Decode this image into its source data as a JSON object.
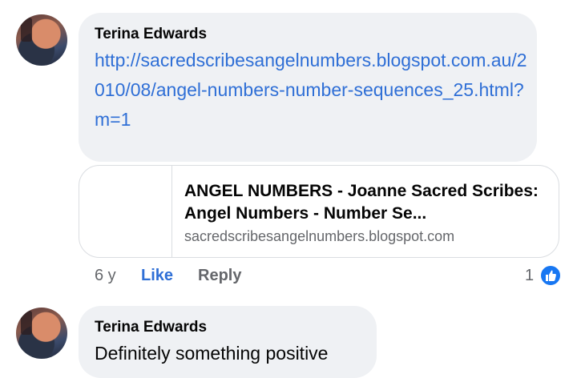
{
  "comments": [
    {
      "author": "Terina Edwards",
      "text": "http://sacredscribesangelnumbers.blogspot.com.au/2010/08/angel-numbers-number-sequences_25.html?m=1",
      "link_preview": {
        "title": "ANGEL NUMBERS - Joanne Sacred Scribes: Angel Numbers - Number Se...",
        "domain": "sacredscribesangelnumbers.blogspot.com"
      },
      "age": "6 y",
      "like_label": "Like",
      "reply_label": "Reply",
      "reaction_count": "1",
      "reaction_icon": "thumbs-up-icon"
    },
    {
      "author": "Terina Edwards",
      "text": "Definitely something positive"
    }
  ],
  "colors": {
    "bubble": "#eff1f4",
    "link": "#2f6fd6",
    "meta": "#65676b",
    "like_badge": "#1877f2"
  }
}
